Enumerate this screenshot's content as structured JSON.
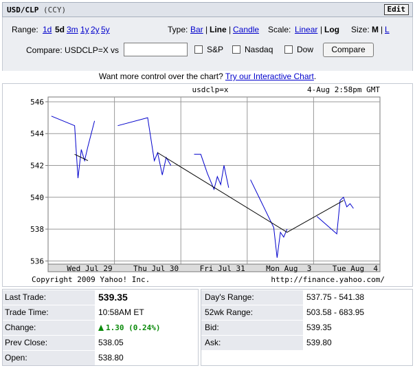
{
  "header": {
    "symbol": "USD/CLP",
    "ccy": "(CCY)",
    "edit_label": "Edit"
  },
  "controls": {
    "range_label": "Range:",
    "ranges": [
      "1d",
      "5d",
      "3m",
      "1y",
      "2y",
      "5y"
    ],
    "range_selected": "5d",
    "type_label": "Type:",
    "types": [
      "Bar",
      "Line",
      "Candle"
    ],
    "type_selected": "Line",
    "scale_label": "Scale:",
    "scales": [
      "Linear",
      "Log"
    ],
    "scale_selected": "Log",
    "size_label": "Size:",
    "sizes": [
      "M",
      "L"
    ],
    "size_selected": "M",
    "compare_label": "Compare: USDCLP=X vs",
    "compare_value": "",
    "checkboxes": [
      "S&P",
      "Nasdaq",
      "Dow"
    ],
    "compare_button": "Compare"
  },
  "promo": {
    "text": "Want more control over the chart?",
    "link": "Try our Interactive Chart",
    "suffix": "."
  },
  "chart_data": {
    "type": "line",
    "title": "usdclp=x",
    "timestamp": "4-Aug 2:58pm GMT",
    "yticks": [
      "546",
      "544",
      "542",
      "540",
      "538",
      "536"
    ],
    "ylim": [
      535.8,
      546.3
    ],
    "xticks": [
      "Wed Jul 29",
      "Thu Jul 30",
      "Fri Jul 31",
      "Mon Aug  3",
      "Tue Aug  4"
    ],
    "copyright": "Copyright 2009 Yahoo! Inc.",
    "source": "http://finance.yahoo.com/",
    "grid": true,
    "series": [
      {
        "color": "#0000cc",
        "values": [
          [
            [
              0.05,
              545.1
            ],
            [
              0.4,
              544.5
            ],
            [
              0.45,
              541.2
            ],
            [
              0.5,
              543.0
            ],
            [
              0.55,
              542.3
            ],
            [
              0.6,
              543.2
            ],
            [
              0.7,
              544.8
            ]
          ],
          [
            [
              1.05,
              544.5
            ],
            [
              1.5,
              545.0
            ],
            [
              1.6,
              542.3
            ],
            [
              1.65,
              542.8
            ],
            [
              1.72,
              541.4
            ],
            [
              1.78,
              542.5
            ],
            [
              1.85,
              542.0
            ]
          ],
          [
            [
              2.2,
              542.7
            ],
            [
              2.3,
              542.7
            ],
            [
              2.4,
              541.5
            ],
            [
              2.5,
              540.5
            ],
            [
              2.55,
              541.3
            ],
            [
              2.6,
              540.8
            ],
            [
              2.65,
              542.0
            ],
            [
              2.72,
              540.6
            ]
          ],
          [
            [
              3.05,
              541.1
            ],
            [
              3.4,
              538.1
            ],
            [
              3.45,
              536.2
            ],
            [
              3.5,
              537.8
            ],
            [
              3.55,
              537.5
            ],
            [
              3.6,
              538.0
            ]
          ],
          [
            [
              4.05,
              538.8
            ],
            [
              4.35,
              537.7
            ],
            [
              4.4,
              539.8
            ],
            [
              4.45,
              540.0
            ],
            [
              4.5,
              539.4
            ],
            [
              4.55,
              539.6
            ],
            [
              4.6,
              539.3
            ]
          ]
        ]
      },
      {
        "color": "#000000",
        "values": [
          [
            [
              0.4,
              542.7
            ],
            [
              0.6,
              542.3
            ]
          ],
          [
            [
              1.65,
              542.8
            ],
            [
              3.6,
              537.8
            ],
            [
              4.45,
              539.8
            ]
          ]
        ]
      }
    ]
  },
  "quote_left": [
    {
      "label": "Last Trade:",
      "value": "539.35"
    },
    {
      "label": "Trade Time:",
      "value": "10:58AM ET"
    },
    {
      "label": "Change:",
      "value": "1.30 (0.24%)"
    },
    {
      "label": "Prev Close:",
      "value": "538.05"
    },
    {
      "label": "Open:",
      "value": "538.80"
    }
  ],
  "quote_right": [
    {
      "label": "Day's Range:",
      "value": "537.75 - 541.38"
    },
    {
      "label": "52wk Range:",
      "value": "503.58 - 683.95"
    },
    {
      "label": "Bid:",
      "value": "539.35"
    },
    {
      "label": "Ask:",
      "value": "539.80"
    }
  ]
}
